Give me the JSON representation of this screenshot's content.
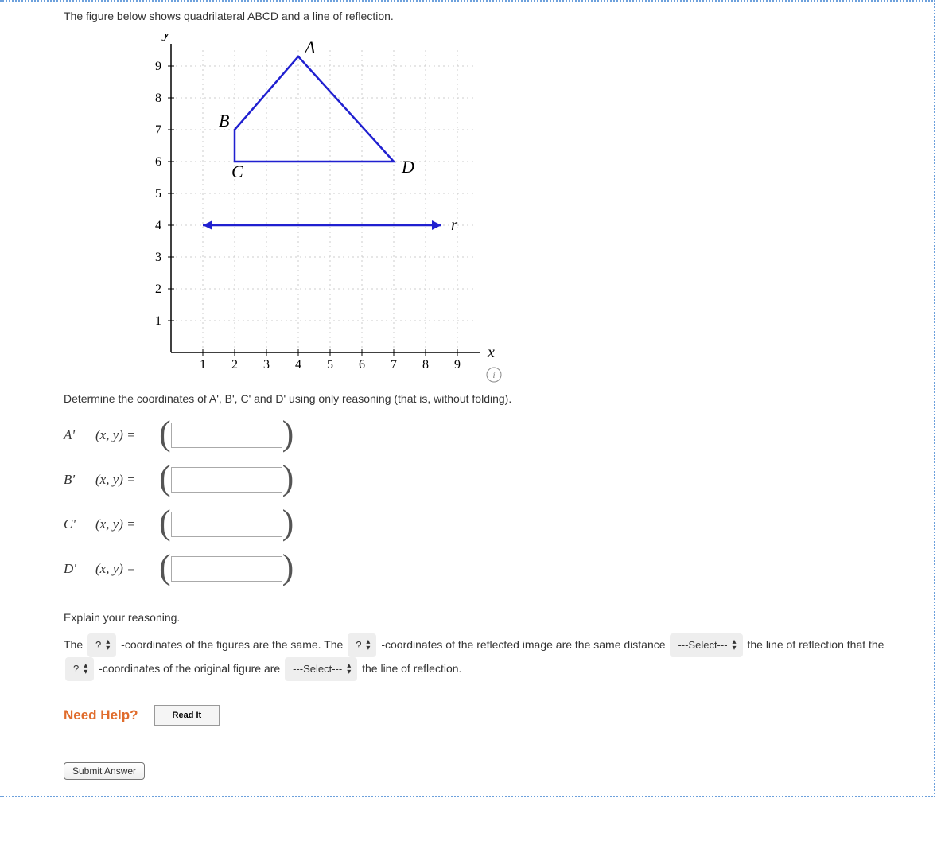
{
  "intro": "The figure below shows quadrilateral ABCD and a line of reflection.",
  "chart_data": {
    "type": "diagram",
    "xlabel": "x",
    "ylabel": "y",
    "xlim": [
      0,
      10
    ],
    "ylim": [
      0,
      10
    ],
    "xticks": [
      1,
      2,
      3,
      4,
      5,
      6,
      7,
      8,
      9
    ],
    "yticks": [
      1,
      2,
      3,
      4,
      5,
      6,
      7,
      8,
      9
    ],
    "points": {
      "A": [
        4,
        9.3
      ],
      "B": [
        2,
        7
      ],
      "C": [
        2,
        6
      ],
      "D": [
        7,
        6
      ]
    },
    "polygon": [
      "A",
      "B",
      "C",
      "D"
    ],
    "reflection_line": {
      "label": "r",
      "y": 4,
      "x_range": [
        1,
        8.5
      ]
    }
  },
  "determine_text": "Determine the coordinates of A', B', C' and D' using only reasoning (that is, without folding).",
  "rows": [
    {
      "label": "A'",
      "xy": "(x, y)  ="
    },
    {
      "label": "B'",
      "xy": "(x, y)  ="
    },
    {
      "label": "C'",
      "xy": "(x, y)  ="
    },
    {
      "label": "D'",
      "xy": "(x, y)  ="
    }
  ],
  "explain_heading": "Explain your reasoning.",
  "fill": {
    "part1": "The ",
    "dd1": "?",
    "part2": " -coordinates of the figures are the same. The ",
    "dd2": "?",
    "part3": " -coordinates of the reflected image are the same distance ",
    "dd3": "---Select---",
    "part4": " the line of reflection that the ",
    "dd4": "?",
    "part5": " -coordinates of the original figure are ",
    "dd5": "---Select---",
    "part6": " the line of reflection."
  },
  "need_help": "Need Help?",
  "read_it": "Read It",
  "submit": "Submit Answer"
}
